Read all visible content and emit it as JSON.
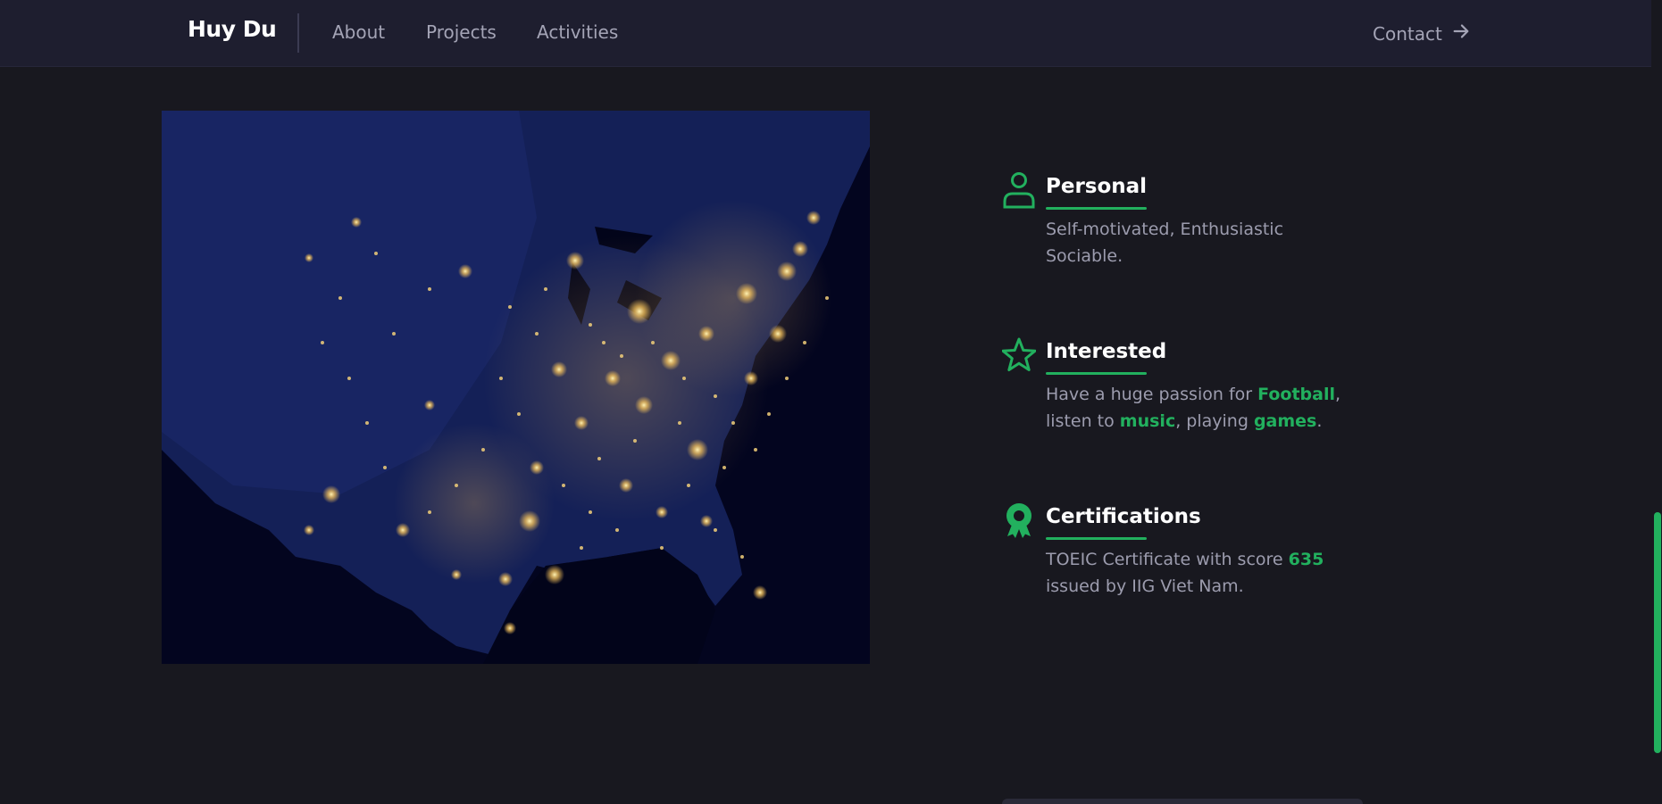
{
  "nav": {
    "brand": "Huy Du",
    "links": [
      "About",
      "Projects",
      "Activities"
    ],
    "contact_label": "Contact",
    "contact_icon": "arrow-right-icon"
  },
  "hero": {
    "image_subject": "night-lights-map-image"
  },
  "features": [
    {
      "icon": "user-icon",
      "title": "Personal",
      "desc_line1": "Self-motivated, Enthusiastic",
      "desc_line2": "Sociable."
    },
    {
      "icon": "star-icon",
      "title": "Interested",
      "desc_pre": "Have a huge passion for ",
      "hl_football": "Football",
      "desc_comma": ",",
      "desc_listen": "listen to ",
      "hl_music": "music",
      "desc_playing": ", playing ",
      "hl_games": "games",
      "desc_end": "."
    },
    {
      "icon": "award-icon",
      "title": "Certifications",
      "desc_pre": "TOEIC Certificate with score ",
      "hl_score": "635",
      "desc_line2": "issued by IIG Viet Nam."
    }
  ],
  "colors": {
    "accent": "#22b05e",
    "background": "#18181f",
    "navbar": "#1e1e2f",
    "muted_text": "#9c9cae"
  }
}
